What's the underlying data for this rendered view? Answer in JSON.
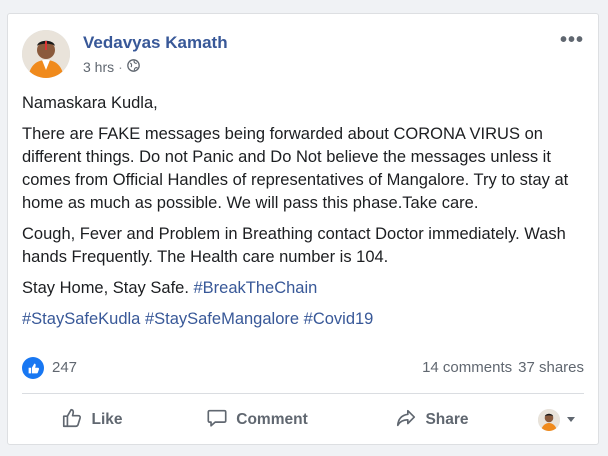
{
  "post": {
    "author": "Vedavyas Kamath",
    "time": "3 hrs",
    "separator": "·",
    "audience_icon": "globe-icon",
    "more_label": "•••",
    "paragraphs": {
      "p1": "Namaskara Kudla,",
      "p2": "There are FAKE messages being forwarded about CORONA VIRUS on different things. Do not Panic and Do Not believe the messages unless it comes from Official Handles of representatives of Mangalore. Try to stay at home as much as possible. We will pass this phase.Take care.",
      "p3": "Cough, Fever and Problem in Breathing contact Doctor immediately. Wash hands Frequently. The Health care number is 104.",
      "p4_text": "Stay Home, Stay Safe. ",
      "p4_tag": "#BreakTheChain",
      "tags": [
        "#StaySafeKudla",
        "#StaySafeMangalore",
        "#Covid19"
      ]
    }
  },
  "stats": {
    "likes": "247",
    "comments": "14 comments",
    "shares": "37 shares"
  },
  "actions": {
    "like": "Like",
    "comment": "Comment",
    "share": "Share"
  },
  "colors": {
    "link": "#385898",
    "like_badge": "#1877f2",
    "muted": "#606770"
  }
}
